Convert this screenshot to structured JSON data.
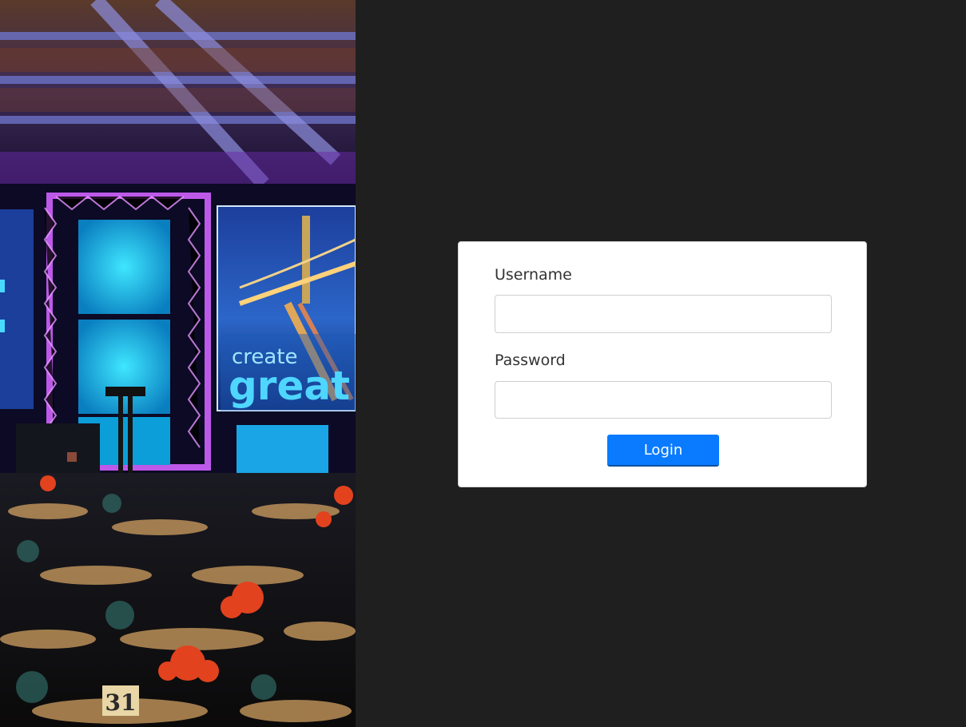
{
  "form": {
    "username_label": "Username",
    "username_value": "",
    "password_label": "Password",
    "password_value": "",
    "login_label": "Login"
  },
  "photo": {
    "screen_text_line1": "create",
    "screen_text_line2": "great",
    "table_number": "31"
  },
  "colors": {
    "background": "#1f1f1f",
    "card": "#ffffff",
    "button": "#0a7bff",
    "label": "#333333"
  }
}
